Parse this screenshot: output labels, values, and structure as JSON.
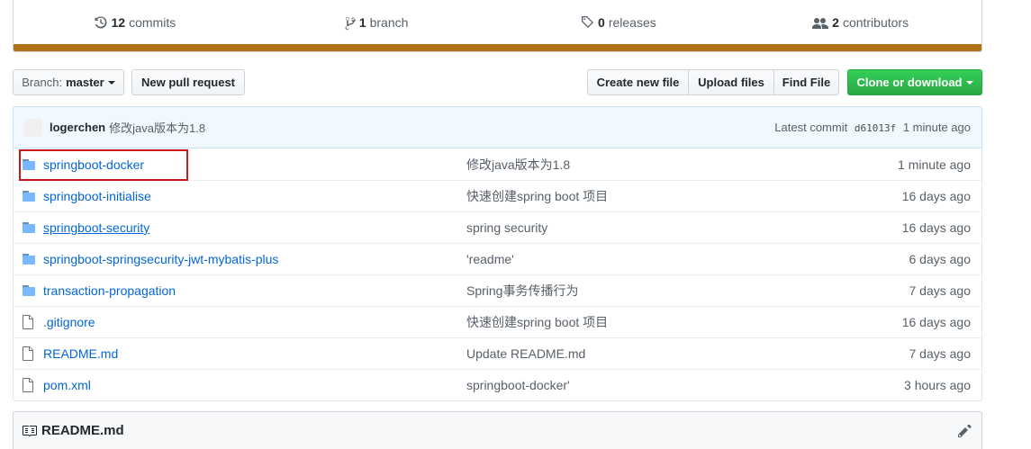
{
  "summary": {
    "commits": {
      "count": "12",
      "label": "commits"
    },
    "branches": {
      "count": "1",
      "label": "branch"
    },
    "releases": {
      "count": "0",
      "label": "releases"
    },
    "contributors": {
      "count": "2",
      "label": "contributors"
    },
    "language_color": "#b07219"
  },
  "toolbar": {
    "branch_prefix": "Branch:",
    "branch_name": "master",
    "new_pr": "New pull request",
    "create_file": "Create new file",
    "upload_files": "Upload files",
    "find_file": "Find File",
    "clone": "Clone or download"
  },
  "commit": {
    "author": "logerchen",
    "message": "修改java版本为1.8",
    "latest_label": "Latest commit",
    "sha": "d61013f",
    "age": "1 minute ago"
  },
  "files": [
    {
      "type": "folder",
      "name": "springboot-docker",
      "message": "修改java版本为1.8",
      "age": "1 minute ago"
    },
    {
      "type": "folder",
      "name": "springboot-initialise",
      "message": "快速创建spring boot 项目",
      "age": "16 days ago"
    },
    {
      "type": "folder",
      "name": "springboot-security",
      "message": "spring security",
      "age": "16 days ago"
    },
    {
      "type": "folder",
      "name": "springboot-springsecurity-jwt-mybatis-plus",
      "message": "'readme'",
      "age": "6 days ago"
    },
    {
      "type": "folder",
      "name": "transaction-propagation",
      "message": "Spring事务传播行为",
      "age": "7 days ago"
    },
    {
      "type": "file",
      "name": ".gitignore",
      "message": "快速创建spring boot 项目",
      "age": "16 days ago"
    },
    {
      "type": "file",
      "name": "README.md",
      "message": "Update README.md",
      "age": "7 days ago"
    },
    {
      "type": "file",
      "name": "pom.xml",
      "message": "springboot-docker'",
      "age": "3 hours ago"
    }
  ],
  "readme": {
    "title": "README.md"
  },
  "colors": {
    "link": "#0366d6",
    "highlight": "#c9171e",
    "green": "#28a745"
  }
}
